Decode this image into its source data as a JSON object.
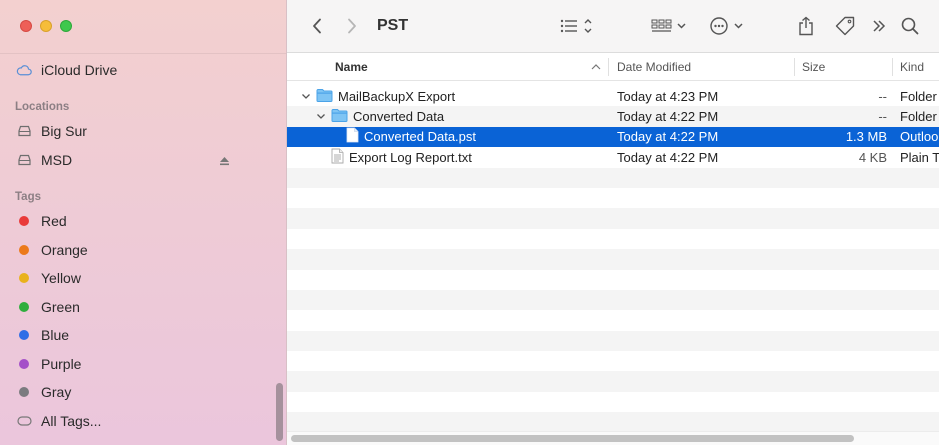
{
  "window": {
    "title": "PST"
  },
  "sidebar": {
    "top_items": [
      {
        "label": "iCloud Drive",
        "icon": "cloud-icon"
      }
    ],
    "locations_label": "Locations",
    "locations": [
      {
        "label": "Big Sur",
        "icon": "disk-icon"
      },
      {
        "label": "MSD",
        "icon": "disk-icon",
        "ejectable": true
      }
    ],
    "tags_label": "Tags",
    "tags": [
      {
        "label": "Red",
        "color": "#e93a3a"
      },
      {
        "label": "Orange",
        "color": "#ec7a1b"
      },
      {
        "label": "Yellow",
        "color": "#e9b21c"
      },
      {
        "label": "Green",
        "color": "#2fae3d"
      },
      {
        "label": "Blue",
        "color": "#2f6ee6"
      },
      {
        "label": "Purple",
        "color": "#a44fc8"
      },
      {
        "label": "Gray",
        "color": "#7b7b7f"
      }
    ],
    "all_tags": "All Tags..."
  },
  "columns": {
    "name": "Name",
    "date": "Date Modified",
    "size": "Size",
    "kind": "Kind"
  },
  "files": [
    {
      "name": "MailBackupX Export",
      "date": "Today at 4:23 PM",
      "size": "--",
      "kind": "Folder",
      "type": "folder",
      "depth": 0,
      "expanded": true,
      "selected": false
    },
    {
      "name": "Converted Data",
      "date": "Today at 4:22 PM",
      "size": "--",
      "kind": "Folder",
      "type": "folder",
      "depth": 1,
      "expanded": true,
      "selected": false
    },
    {
      "name": "Converted Data.pst",
      "date": "Today at 4:22 PM",
      "size": "1.3 MB",
      "kind": "Outloo",
      "type": "file",
      "depth": 2,
      "selected": true
    },
    {
      "name": "Export Log Report.txt",
      "date": "Today at 4:22 PM",
      "size": "4 KB",
      "kind": "Plain T",
      "type": "text",
      "depth": 1,
      "selected": false
    }
  ],
  "colors": {
    "selection": "#0a63d6",
    "folder": "#4ba3e8"
  }
}
